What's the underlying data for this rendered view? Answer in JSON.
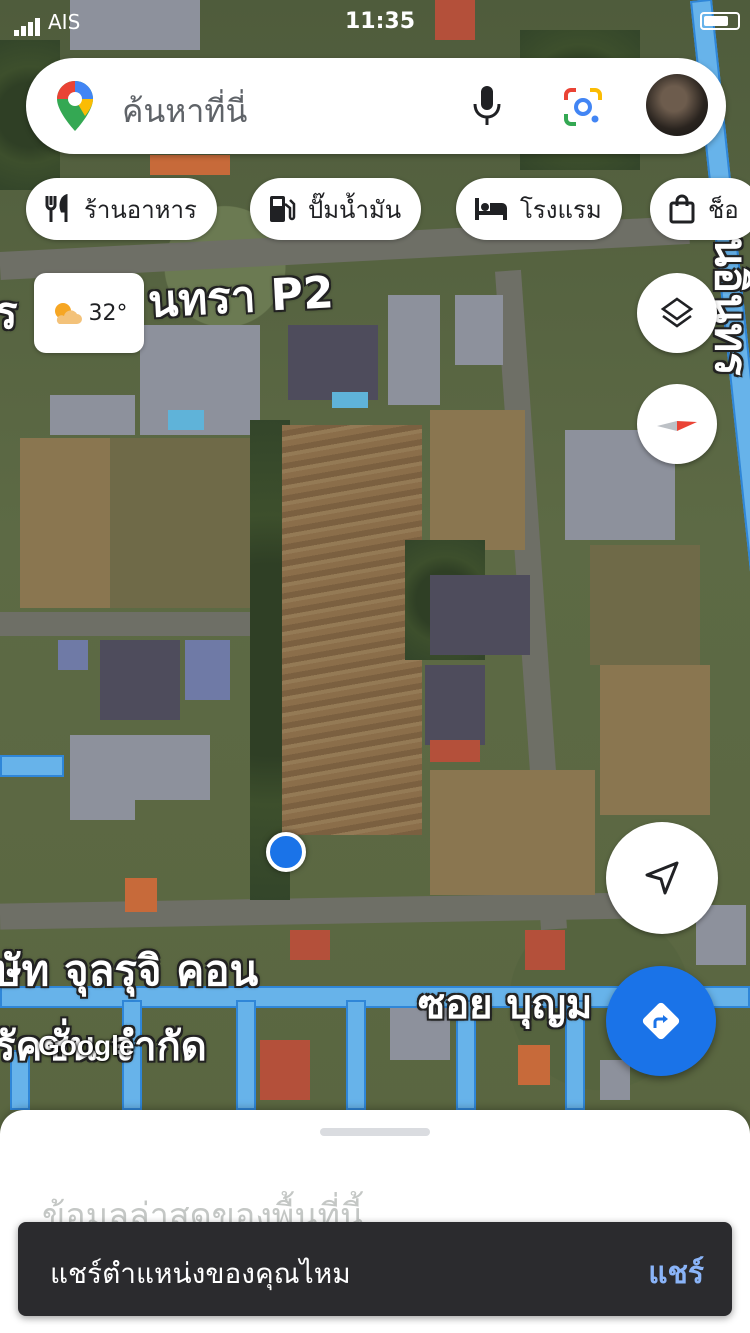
{
  "status_bar": {
    "carrier": "AIS",
    "time": "11:35"
  },
  "search": {
    "placeholder": "ค้นหาที่นี่"
  },
  "chips": [
    {
      "label": "ร้านอาหาร",
      "icon": "restaurant-icon"
    },
    {
      "label": "ปั๊มน้ำมัน",
      "icon": "gas-station-icon"
    },
    {
      "label": "โรงแรม",
      "icon": "hotel-icon"
    },
    {
      "label": "ช็อ",
      "icon": "shopping-bag-icon"
    }
  ],
  "weather": {
    "temp": "32°",
    "icon": "partly-cloudy-icon"
  },
  "map_labels": {
    "road_top": "นทรา P2",
    "road_top_prefix": "ร",
    "company_line1": "ษัท จุลรุจิ คอน",
    "company_line2": "รัคชั่น จำกัด",
    "soi": "ซอย บุญม",
    "vertical_road": "ถนนอินทร",
    "watermark": "Google"
  },
  "sheet": {
    "title": "ข้อมูลล่าสุดของพื้นที่นี้..."
  },
  "snackbar": {
    "message": "แชร์ตำแหน่งของคุณไหม",
    "action": "แชร์"
  },
  "colors": {
    "accent": "#1a73e8",
    "snackbar_action": "#8ab4f8"
  }
}
